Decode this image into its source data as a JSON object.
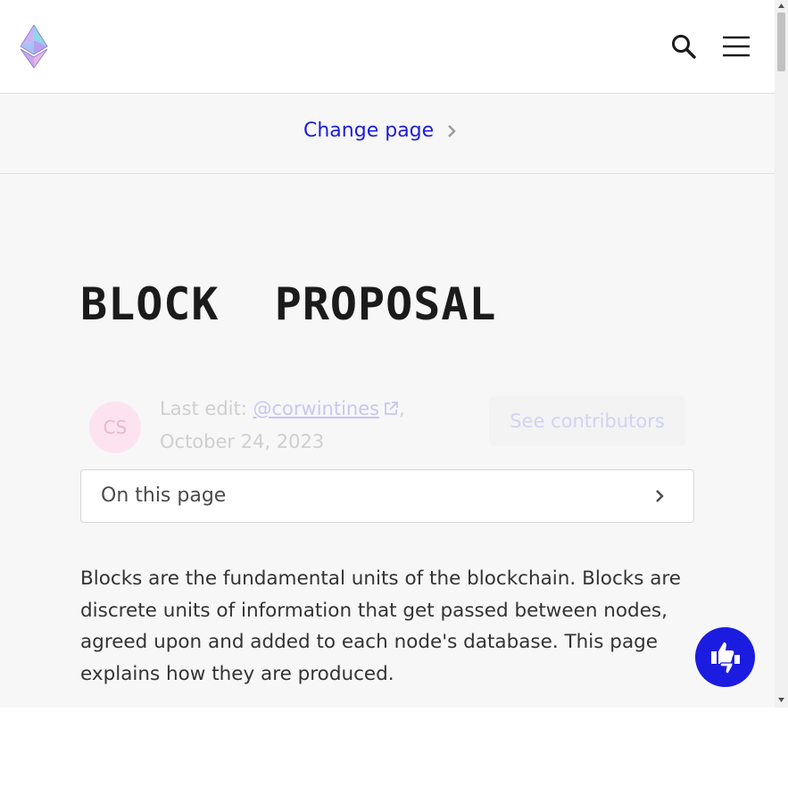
{
  "header": {
    "logo_icon": "ethereum-logo-icon",
    "search_icon": "search-icon",
    "menu_icon": "hamburger-menu-icon"
  },
  "change_page": {
    "label": "Change page",
    "icon": "chevron-right-icon",
    "link_color": "#1c1ce1"
  },
  "page": {
    "title": "BLOCK  PROPOSAL"
  },
  "meta": {
    "avatar_initials": "CS",
    "last_edit_prefix": "Last edit: ",
    "author": "@corwintines",
    "date": "October 24, 2023",
    "see_contributors": "See contributors"
  },
  "toc": {
    "label": "On this page"
  },
  "content": {
    "intro": "Blocks are the fundamental units of the blockchain. Blocks are discrete units of information that get passed between nodes, agreed upon and added to each node's database. This page explains how they are produced."
  },
  "feedback": {
    "icon": "thumbs-up-down-icon",
    "color": "#1c1ce1"
  }
}
